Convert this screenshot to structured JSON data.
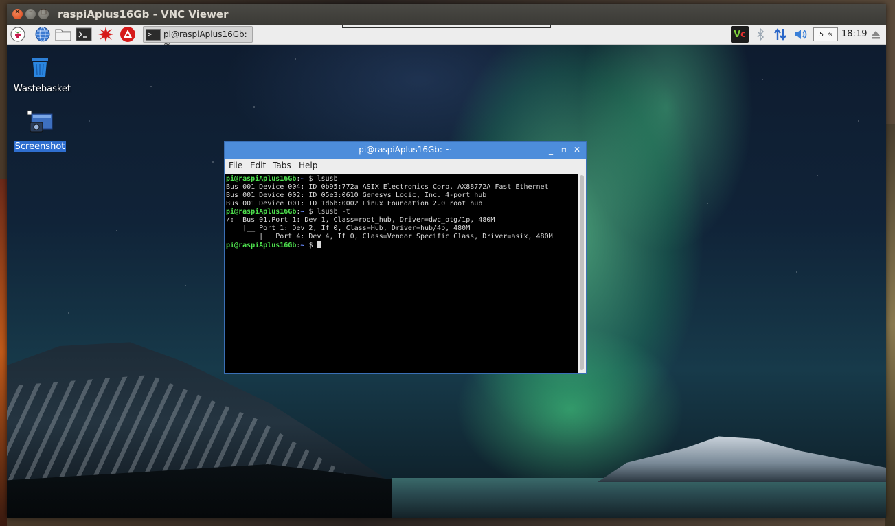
{
  "vnc": {
    "title": "raspiAplus16Gb - VNC Viewer"
  },
  "panel": {
    "taskbar_label": "pi@raspiAplus16Gb: ~",
    "cpu_usage": "5 %",
    "clock": "18:19",
    "launchers": [
      "raspberry-menu-icon",
      "web-browser-icon",
      "file-manager-icon",
      "terminal-icon",
      "math-icon",
      "wolfram-icon"
    ],
    "tray_vnc_label": "V",
    "tray_vnc_label_2": "c"
  },
  "desktop": {
    "icons": [
      {
        "label": "Wastebasket"
      },
      {
        "label": "Screenshot"
      }
    ]
  },
  "terminal": {
    "title": "pi@raspiAplus16Gb: ~",
    "menu": [
      "File",
      "Edit",
      "Tabs",
      "Help"
    ],
    "prompt_user": "pi@raspiAplus16Gb",
    "prompt_sep": ":",
    "prompt_path": "~",
    "prompt_symbol": " $ ",
    "commands": [
      "lsusb",
      "lsusb -t"
    ],
    "output_lsusb": [
      "Bus 001 Device 004: ID 0b95:772a ASIX Electronics Corp. AX88772A Fast Ethernet",
      "Bus 001 Device 002: ID 05e3:0610 Genesys Logic, Inc. 4-port hub",
      "Bus 001 Device 001: ID 1d6b:0002 Linux Foundation 2.0 root hub"
    ],
    "output_tree": [
      "/:  Bus 01.Port 1: Dev 1, Class=root_hub, Driver=dwc_otg/1p, 480M",
      "    |__ Port 1: Dev 2, If 0, Class=Hub, Driver=hub/4p, 480M",
      "        |__ Port 4: Dev 4, If 0, Class=Vendor Specific Class, Driver=asix, 480M"
    ]
  },
  "colors": {
    "terminal_title_bar": "#4d8ddb",
    "prompt_green": "#4de04d",
    "prompt_blue": "#6a8cff",
    "selected_label": "#2f6fd0"
  }
}
